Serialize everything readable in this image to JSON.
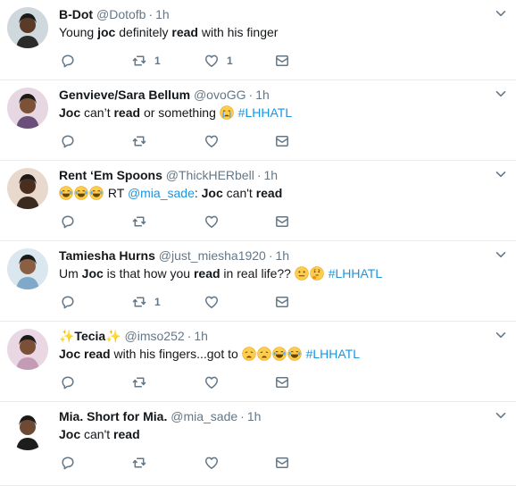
{
  "tweets": [
    {
      "name": "B-Dot",
      "handle": "@Dotofb",
      "time": "1h",
      "text": [
        {
          "t": "Young ",
          "style": "plain"
        },
        {
          "t": "joc",
          "style": "bold"
        },
        {
          "t": " definitely ",
          "style": "plain"
        },
        {
          "t": "read",
          "style": "bold"
        },
        {
          "t": " with his finger",
          "style": "plain"
        }
      ],
      "retweets": "1",
      "likes": "1",
      "avatar_color": "#2b2b2b"
    },
    {
      "name": "Genvieve/Sara Bellum",
      "handle": "@ovoGG",
      "time": "1h",
      "text": [
        {
          "t": "Joc",
          "style": "bold"
        },
        {
          "t": " can’t ",
          "style": "plain"
        },
        {
          "t": "read",
          "style": "bold"
        },
        {
          "t": " or something ",
          "style": "plain"
        },
        {
          "t": "",
          "style": "emoji",
          "icon": "crying-emoji"
        },
        {
          "t": " ",
          "style": "plain"
        },
        {
          "t": "#LHHATL",
          "style": "hashtag"
        }
      ],
      "retweets": "",
      "likes": "",
      "avatar_color": "#6a4f7a"
    },
    {
      "name": "Rent ‘Em Spoons",
      "handle": "@ThickHERbell",
      "time": "1h",
      "text": [
        {
          "t": "",
          "style": "emoji",
          "icon": "laughing-emoji"
        },
        {
          "t": "",
          "style": "emoji",
          "icon": "laughing-emoji"
        },
        {
          "t": "",
          "style": "emoji",
          "icon": "laughing-emoji"
        },
        {
          "t": " RT ",
          "style": "plain"
        },
        {
          "t": "@mia_sade",
          "style": "mention"
        },
        {
          "t": ": ",
          "style": "plain"
        },
        {
          "t": "Joc",
          "style": "bold"
        },
        {
          "t": " can't ",
          "style": "plain"
        },
        {
          "t": "read",
          "style": "bold"
        }
      ],
      "retweets": "",
      "likes": "",
      "avatar_color": "#3a2a20"
    },
    {
      "name": "Tamiesha Hurns",
      "handle": "@just_miesha1920",
      "time": "1h",
      "text": [
        {
          "t": "Um ",
          "style": "plain"
        },
        {
          "t": "Joc",
          "style": "bold"
        },
        {
          "t": " is that how you ",
          "style": "plain"
        },
        {
          "t": "read",
          "style": "bold"
        },
        {
          "t": " in real life?? ",
          "style": "plain"
        },
        {
          "t": "",
          "style": "emoji",
          "icon": "neutral-face-emoji"
        },
        {
          "t": "",
          "style": "emoji",
          "icon": "thinking-face-emoji"
        },
        {
          "t": " ",
          "style": "plain"
        },
        {
          "t": "#LHHATL",
          "style": "hashtag"
        }
      ],
      "retweets": "1",
      "likes": "",
      "avatar_color": "#7fa8c9"
    },
    {
      "name": "✨Tecia✨",
      "handle": "@imso252",
      "time": "1h",
      "text": [
        {
          "t": "Joc",
          "style": "bold"
        },
        {
          "t": " ",
          "style": "plain"
        },
        {
          "t": "read",
          "style": "bold"
        },
        {
          "t": " with his fingers...got to ",
          "style": "plain"
        },
        {
          "t": "",
          "style": "emoji",
          "icon": "weary-face-emoji"
        },
        {
          "t": "",
          "style": "emoji",
          "icon": "weary-face-emoji"
        },
        {
          "t": "",
          "style": "emoji",
          "icon": "laughing-emoji"
        },
        {
          "t": "",
          "style": "emoji",
          "icon": "laughing-emoji"
        },
        {
          "t": " ",
          "style": "plain"
        },
        {
          "t": "#LHHATL",
          "style": "hashtag"
        }
      ],
      "retweets": "",
      "likes": "",
      "avatar_color": "#c49bb5"
    },
    {
      "name": "Mia. Short for Mia.",
      "handle": "@mia_sade",
      "time": "1h",
      "text": [
        {
          "t": "Joc",
          "style": "bold"
        },
        {
          "t": " can't ",
          "style": "plain"
        },
        {
          "t": "read",
          "style": "bold"
        }
      ],
      "retweets": "",
      "likes": "",
      "avatar_color": "#1d1d1d"
    }
  ],
  "colors": {
    "icon_gray": "#657786",
    "link_blue": "#1b95e0",
    "divider": "#e6ecf0"
  }
}
